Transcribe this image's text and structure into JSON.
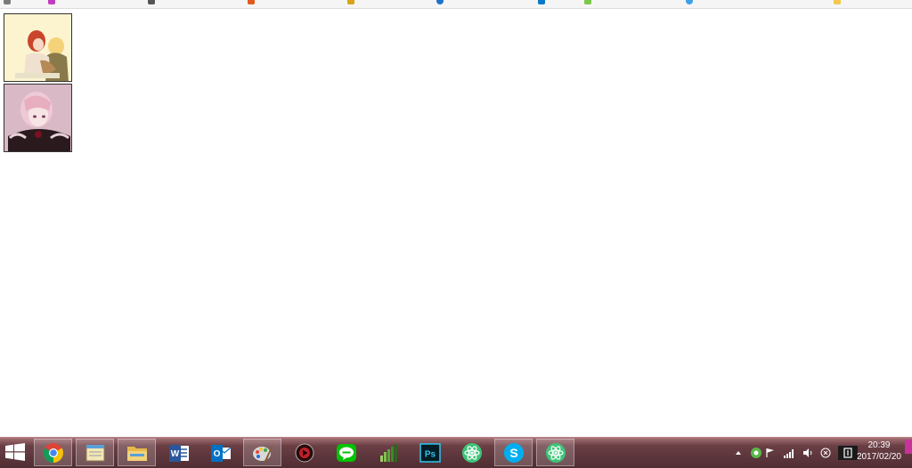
{
  "clock": {
    "time": "20:39",
    "date": "2017/02/20"
  },
  "taskbar_icons": [
    "windows-start-icon",
    "chrome-icon",
    "notepad-icon",
    "file-explorer-icon",
    "word-icon",
    "outlook-icon",
    "paint-icon",
    "media-player-icon",
    "line-icon",
    "charts-app-icon",
    "photoshop-icon",
    "atom-icon",
    "skype-icon",
    "atom-icon"
  ],
  "colors": {
    "taskbar": "#5a323a",
    "active_button": "rgba(255,255,255,0.18)",
    "show_desktop": "#c8329b"
  }
}
